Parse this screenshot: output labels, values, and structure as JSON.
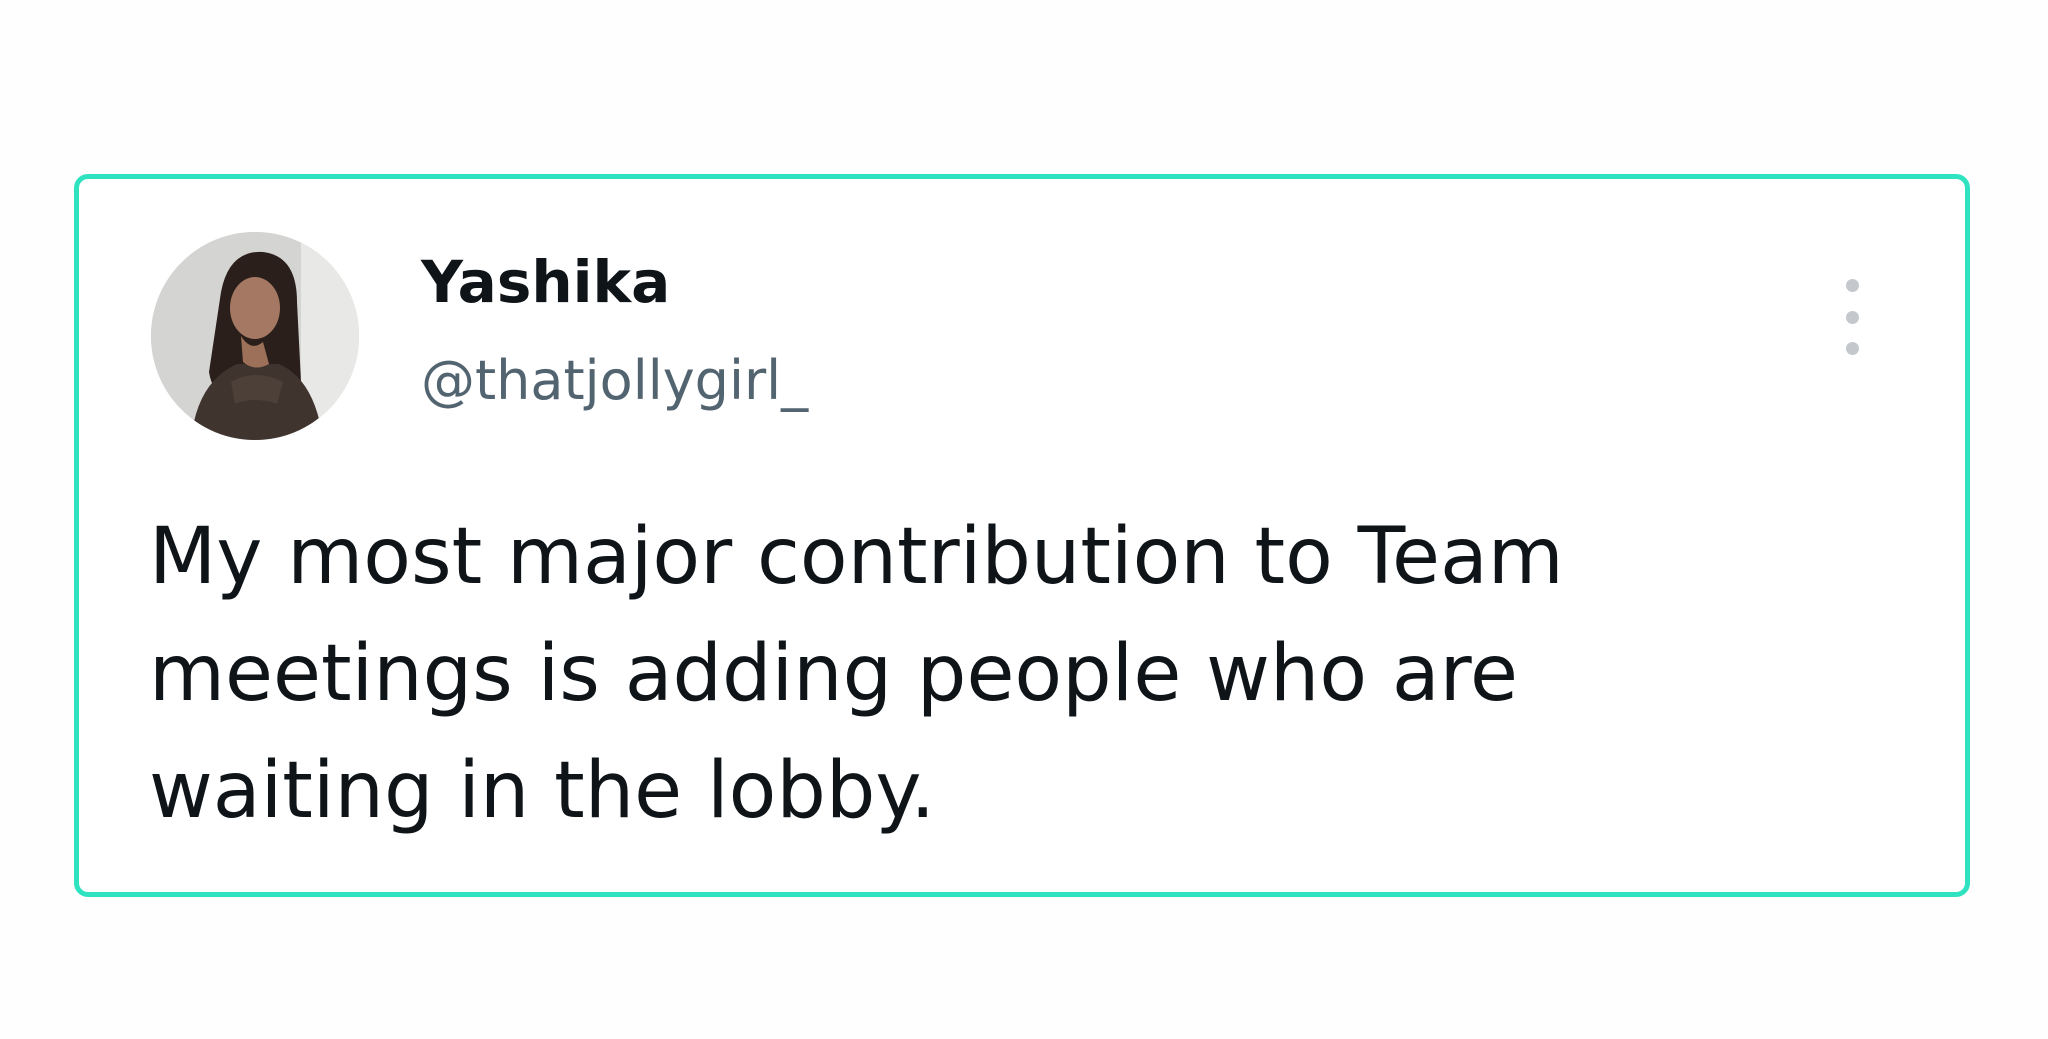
{
  "tweet": {
    "author": {
      "name": "Yashika",
      "handle": "@thatjollygirl_"
    },
    "text_lines": [
      "My most major contribution to Team",
      "meetings is adding people who are",
      "waiting in the lobby."
    ],
    "menu_icon": "more-vertical-icon"
  },
  "colors": {
    "card_border": "#2fe3c0",
    "text_primary": "#0f1419",
    "text_secondary": "#536471",
    "menu_dots": "#c4c8cc"
  }
}
